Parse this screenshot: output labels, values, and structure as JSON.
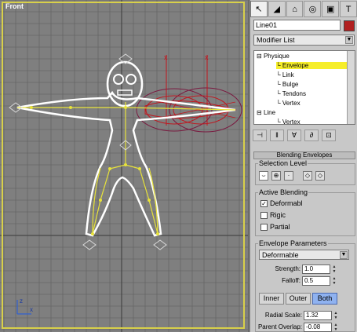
{
  "viewport": {
    "label": "Front",
    "colors": {
      "background": "#7f7f7f",
      "grid": "#5e5e5e",
      "frame": "#d8d04a",
      "spline": "#ffffff",
      "bones": "#e7e23a",
      "envelope": "#c0161e"
    },
    "axis_gizmo": {
      "x_label": "x",
      "z_label": "z"
    }
  },
  "command_panel": {
    "tabs": [
      {
        "name": "create-tab",
        "glyph": "↖",
        "active": true
      },
      {
        "name": "modify-tab",
        "glyph": "◢",
        "active": false
      },
      {
        "name": "hierarchy-tab",
        "glyph": "⌂",
        "active": false
      },
      {
        "name": "motion-tab",
        "glyph": "◎",
        "active": false
      },
      {
        "name": "display-tab",
        "glyph": "▣",
        "active": false
      },
      {
        "name": "utilities-tab",
        "glyph": "T",
        "active": false
      }
    ],
    "object_name": "Line01",
    "object_color": "#b12020",
    "modifier_list": "Modifier List",
    "stack": [
      {
        "label": "Physique",
        "level": 0,
        "expanded": true,
        "selected": false
      },
      {
        "label": "Envelope",
        "level": 1,
        "selected": true
      },
      {
        "label": "Link",
        "level": 1,
        "selected": false
      },
      {
        "label": "Bulge",
        "level": 1,
        "selected": false
      },
      {
        "label": "Tendons",
        "level": 1,
        "selected": false
      },
      {
        "label": "Vertex",
        "level": 1,
        "selected": false
      },
      {
        "label": "Line",
        "level": 0,
        "expanded": true,
        "selected": false
      },
      {
        "label": "Vertex",
        "level": 1,
        "selected": false
      }
    ],
    "stack_toolbar": [
      "pin-stack",
      "show-end-result",
      "make-unique",
      "remove-modifier",
      "configure-sets"
    ],
    "stack_toolbar_glyphs": [
      "⊣",
      "‖",
      "∀",
      "∂",
      "⊡"
    ],
    "rollout_title": "Blending Envelopes",
    "selection_level": {
      "title": "Selection Level",
      "icons": [
        "link-level",
        "vertex-level",
        "small-level",
        "prev-link",
        "next-link"
      ],
      "glyphs": [
        "⌣",
        "⊕",
        "·",
        "◇",
        "◇"
      ]
    },
    "active_blending": {
      "title": "Active Blending",
      "options": [
        {
          "label": "Deformabl",
          "checked": true,
          "mark": "✓"
        },
        {
          "label": "Rigic",
          "checked": false,
          "mark": ""
        },
        {
          "label": "Partial",
          "checked": false,
          "mark": ""
        }
      ]
    },
    "envelope_parameters": {
      "title": "Envelope Parameters",
      "type": "Deformable",
      "strength_label": "Strength:",
      "strength_value": "1.0",
      "falloff_label": "Falloff:",
      "falloff_value": "0.5",
      "buttons": [
        {
          "label": "Inner",
          "active": false
        },
        {
          "label": "Outer",
          "active": false
        },
        {
          "label": "Both",
          "active": true
        }
      ],
      "radial_scale_label": "Radial Scale:",
      "radial_scale_value": "1.32",
      "parent_overlap_label": "Parent Overlap:",
      "parent_overlap_value": "-0.08"
    }
  }
}
